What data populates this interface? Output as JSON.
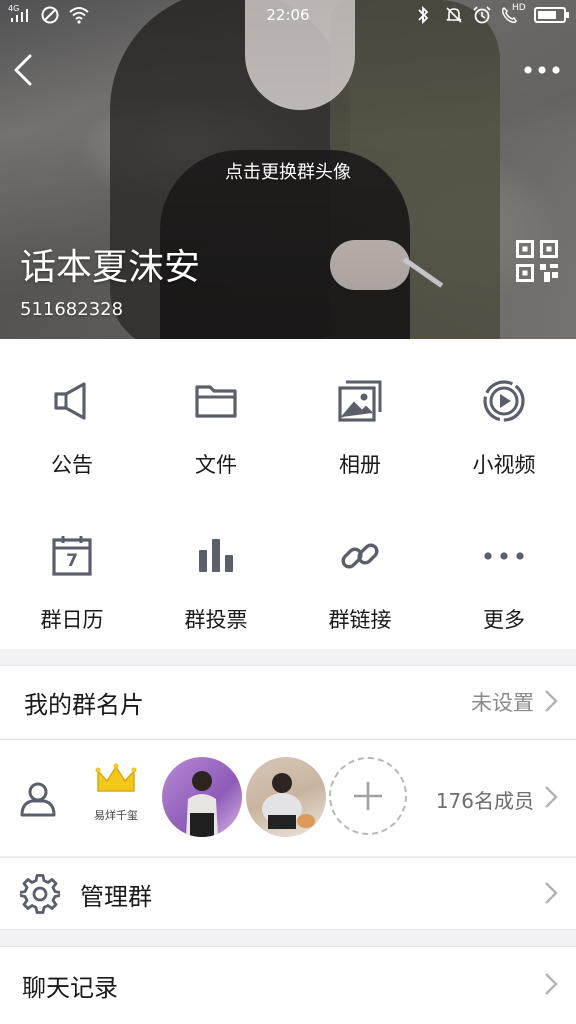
{
  "status_bar": {
    "network": "4G",
    "time": "22:06",
    "hd_label": "HD",
    "battery_level": 0.75
  },
  "header": {
    "change_avatar_hint": "点击更换群头像",
    "group_name": "话本夏沫安",
    "group_id": "511682328"
  },
  "features": [
    {
      "label": "公告",
      "icon": "megaphone-icon"
    },
    {
      "label": "文件",
      "icon": "folder-icon"
    },
    {
      "label": "相册",
      "icon": "album-icon"
    },
    {
      "label": "小视频",
      "icon": "video-icon"
    },
    {
      "label": "群日历",
      "icon": "calendar-icon"
    },
    {
      "label": "群投票",
      "icon": "vote-chart-icon"
    },
    {
      "label": "群链接",
      "icon": "link-icon"
    },
    {
      "label": "更多",
      "icon": "more-dots-icon"
    }
  ],
  "calendar_day": "7",
  "group_card": {
    "title": "我的群名片",
    "value": "未设置"
  },
  "members": {
    "crown_caption": "易烊千玺",
    "count_label": "176名成员"
  },
  "manage": {
    "title": "管理群"
  },
  "chat_history": {
    "title": "聊天记录"
  },
  "colors": {
    "icon_gray": "#5b5f6b",
    "crown_yellow": "#f2c81a"
  }
}
